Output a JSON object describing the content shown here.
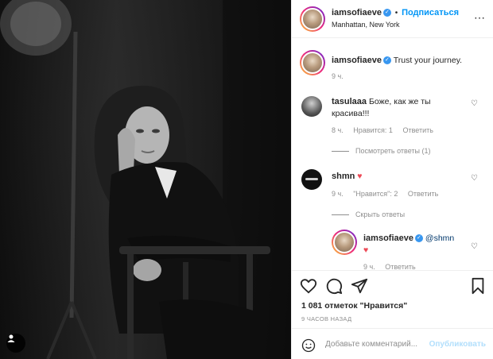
{
  "post": {
    "username": "iamsofiaeve",
    "follow_label": "Подписаться",
    "location": "Manhattan, New York",
    "more_icon": "more-dots-icon",
    "verified_icon": "verified-badge-icon"
  },
  "caption": {
    "username": "iamsofiaeve",
    "text": "Trust your journey.",
    "age": "9 ч."
  },
  "comments": [
    {
      "username": "tasulaaa",
      "text": "Боже, как же ты красива!!!",
      "age": "8 ч.",
      "likes_label": "Нравится: 1",
      "reply_label": "Ответить",
      "thread_label": "Посмотреть ответы (1)"
    },
    {
      "username": "shmn",
      "text": "♥",
      "age": "9 ч.",
      "likes_label": "\"Нравится\": 2",
      "reply_label": "Ответить",
      "thread_label": "Скрыть ответы"
    }
  ],
  "reply": {
    "username": "iamsofiaeve",
    "mention": "@shmn",
    "text": "♥",
    "age": "9 ч.",
    "reply_label": "Ответить"
  },
  "actions": {
    "likes": "1 081 отметок \"Нравится\"",
    "time": "9 ЧАСОВ НАЗАД",
    "comment_placeholder": "Добавьте комментарий...",
    "publish_label": "Опубликовать"
  },
  "colors": {
    "accent": "#0095f6",
    "heart": "#ed4956"
  }
}
